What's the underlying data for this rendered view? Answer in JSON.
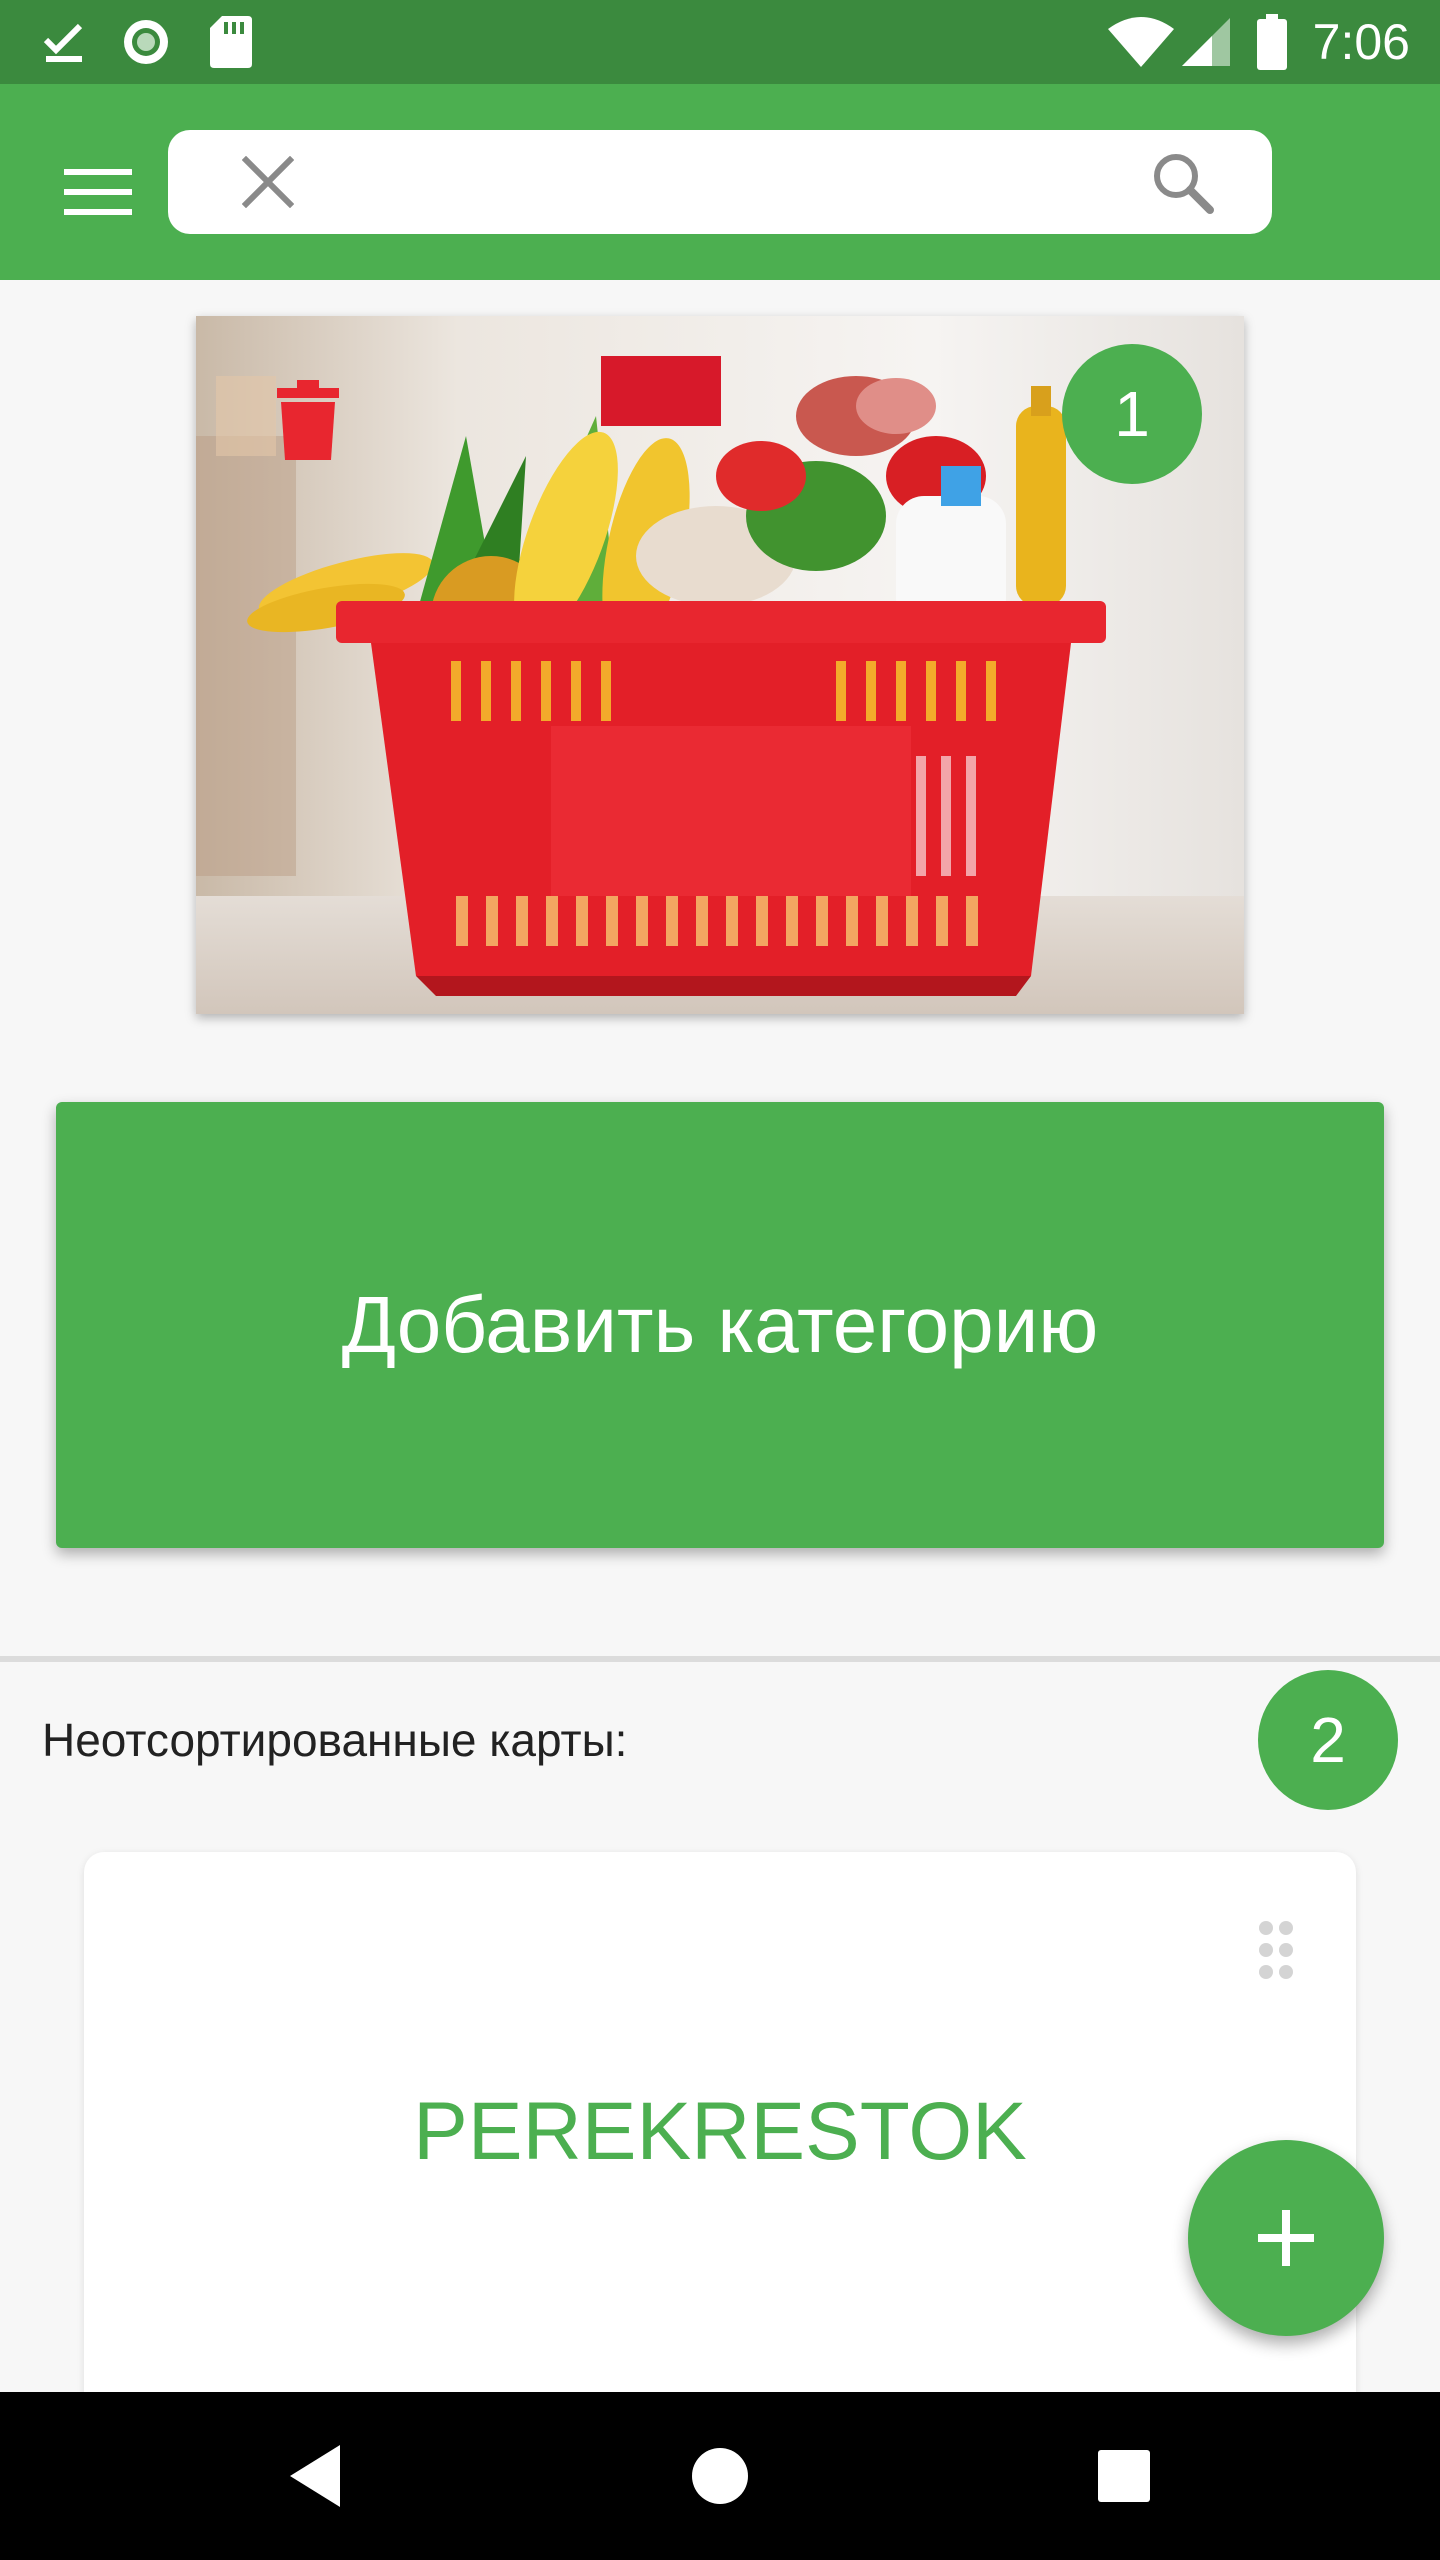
{
  "status_bar": {
    "time": "7:06",
    "icons": [
      "task-done-icon",
      "record-icon",
      "sd-card-icon",
      "wifi-icon",
      "signal-icon",
      "battery-icon"
    ]
  },
  "toolbar": {
    "menu_icon": "menu-icon",
    "search": {
      "value": "",
      "placeholder": "",
      "clear_icon": "close-icon",
      "search_icon": "search-icon"
    }
  },
  "category": {
    "delete_icon": "trash-icon",
    "count": "1"
  },
  "add_category_label": "Добавить категорию",
  "unsorted": {
    "title": "Неотсортированные карты:",
    "count": "2",
    "cards": [
      {
        "name": "PEREKRESTOK",
        "drag_icon": "drag-handle-icon"
      }
    ]
  },
  "fab_icon": "plus-icon",
  "nav_bar": {
    "buttons": [
      "back-icon",
      "home-icon",
      "recents-icon"
    ]
  },
  "colors": {
    "primary": "#4caf50",
    "status_bar": "#3b8a3e",
    "accent_red": "#e8262f"
  }
}
